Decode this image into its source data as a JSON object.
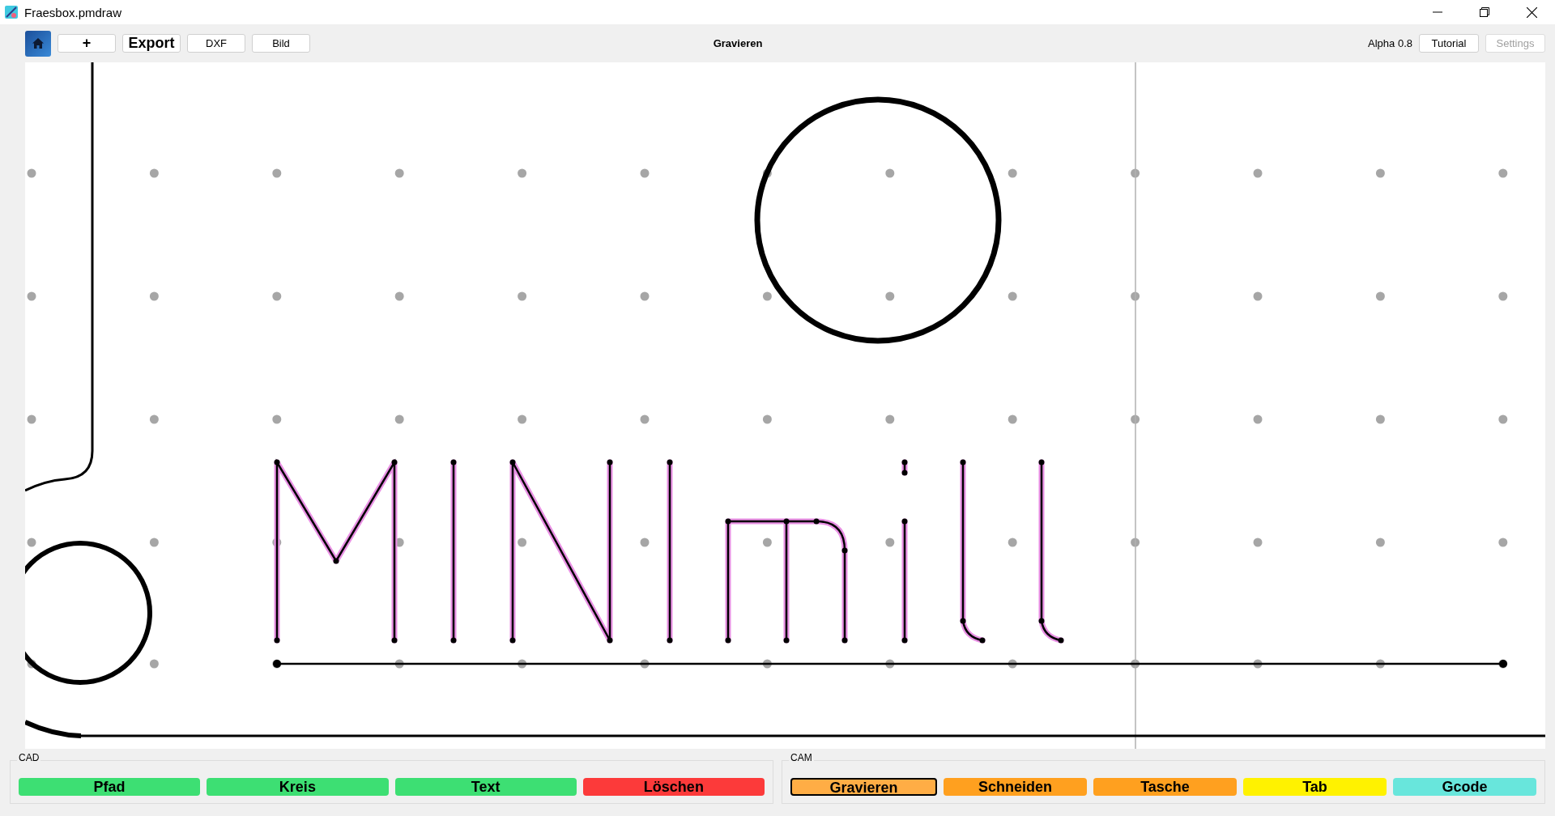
{
  "window": {
    "title": "Fraesbox.pmdraw"
  },
  "toolbar": {
    "buttons": [
      {
        "label": "+",
        "kind": "bold"
      },
      {
        "label": "Export",
        "kind": "bold"
      },
      {
        "label": "DXF",
        "kind": "plain"
      },
      {
        "label": "Bild",
        "kind": "plain"
      }
    ],
    "mode": "Gravieren",
    "version": "Alpha 0.8",
    "right_buttons": [
      {
        "label": "Tutorial",
        "disabled": false
      },
      {
        "label": "Settings",
        "disabled": true
      }
    ]
  },
  "groups": [
    {
      "title": "CAD",
      "buttons": [
        {
          "label": "Pfad",
          "color": "#3ddf73",
          "selected": false
        },
        {
          "label": "Kreis",
          "color": "#3ddf73",
          "selected": false
        },
        {
          "label": "Text",
          "color": "#3ddf73",
          "selected": false
        },
        {
          "label": "Löschen",
          "color": "#fc3a3a",
          "selected": false
        }
      ]
    },
    {
      "title": "CAM",
      "buttons": [
        {
          "label": "Gravieren",
          "color": "#ffad45",
          "selected": true
        },
        {
          "label": "Schneiden",
          "color": "#ffa01f",
          "selected": false
        },
        {
          "label": "Tasche",
          "color": "#ffa01f",
          "selected": false
        },
        {
          "label": "Tab",
          "color": "#fff200",
          "selected": false
        },
        {
          "label": "Gcode",
          "color": "#68e6dc",
          "selected": false
        }
      ]
    }
  ]
}
